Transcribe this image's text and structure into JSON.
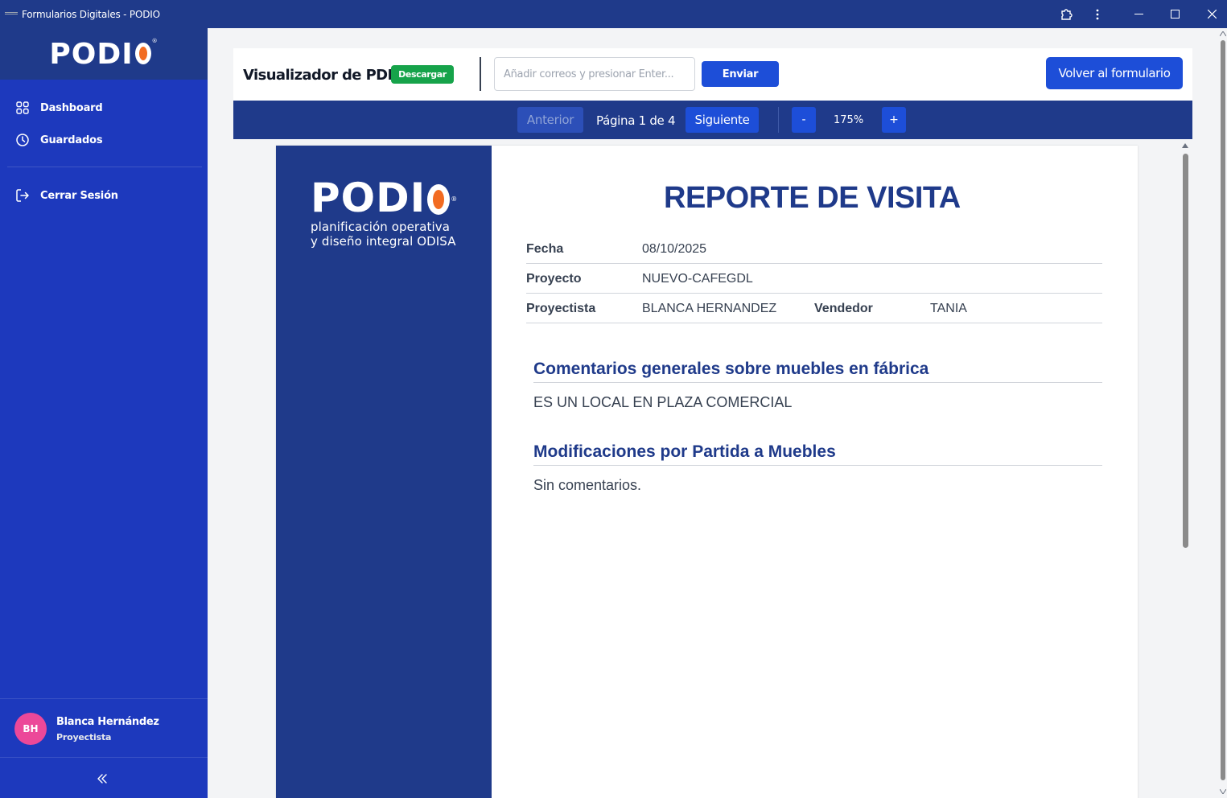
{
  "window": {
    "title": "Formularios Digitales - PODIO"
  },
  "sidebar": {
    "logo_text": "PODI",
    "nav": [
      {
        "label": "Dashboard",
        "icon": "grid-icon"
      },
      {
        "label": "Guardados",
        "icon": "clock-icon"
      },
      {
        "label": "Cerrar Sesión",
        "icon": "logout-icon"
      }
    ],
    "user": {
      "initials": "BH",
      "name": "Blanca Hernández",
      "role": "Proyectista"
    }
  },
  "toolbar": {
    "title": "Visualizador de PDF",
    "download_label": "Descargar",
    "email_placeholder": "Añadir correos y presionar Enter...",
    "email_value": "",
    "send_label": "Enviar",
    "back_label": "Volver al formulario"
  },
  "pager": {
    "prev_label": "Anterior",
    "page_indicator": "Página 1 de 4",
    "next_label": "Siguiente",
    "zoom_out_label": "-",
    "zoom_value": "175%",
    "zoom_in_label": "+"
  },
  "document": {
    "logo_text": "PODI",
    "tagline_line1": "planificación operativa",
    "tagline_line2": "y diseño integral ODISA",
    "title": "REPORTE DE VISITA",
    "fields": {
      "fecha_label": "Fecha",
      "fecha_value": "08/10/2025",
      "proyecto_label": "Proyecto",
      "proyecto_value": "NUEVO-CAFEGDL",
      "proyectista_label": "Proyectista",
      "proyectista_value": "BLANCA HERNANDEZ",
      "vendedor_label": "Vendedor",
      "vendedor_value": "TANIA"
    },
    "sections": [
      {
        "heading": "Comentarios generales sobre muebles en fábrica",
        "body": "ES UN LOCAL EN PLAZA COMERCIAL"
      },
      {
        "heading": "Modificaciones por Partida a Muebles",
        "body": "Sin comentarios."
      }
    ]
  },
  "colors": {
    "brand_navy": "#1f3a8a",
    "sidebar_blue": "#1d39bd",
    "accent_blue": "#1d4ed8",
    "download_green": "#16a34a",
    "logo_orange": "#f26b21",
    "avatar_pink": "#ec4899"
  }
}
